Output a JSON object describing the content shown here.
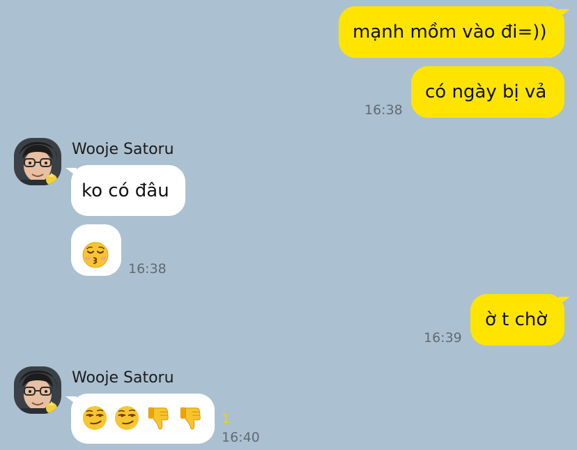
{
  "colors": {
    "background": "#abc1d1",
    "my_bubble": "#ffe400",
    "their_bubble": "#ffffff",
    "unread_count": "#f3d400"
  },
  "messages": [
    {
      "sender": "me",
      "text": "mạnh mồm vào đi=))"
    },
    {
      "sender": "me",
      "text": "có ngày bị vả",
      "time": "16:38"
    },
    {
      "sender": "them",
      "name": "Wooje Satoru",
      "text": "ko có đâu"
    },
    {
      "sender": "them",
      "emoji": "kissing-face-closed-eyes-icon",
      "time": "16:38"
    },
    {
      "sender": "me",
      "text": "ờ t chờ",
      "time": "16:39"
    },
    {
      "sender": "them",
      "name": "Wooje Satoru",
      "emoji": [
        "smirk-icon",
        "smirk-icon",
        "thumbs-down-icon",
        "thumbs-down-icon"
      ],
      "unread": "1",
      "time": "16:40"
    }
  ]
}
